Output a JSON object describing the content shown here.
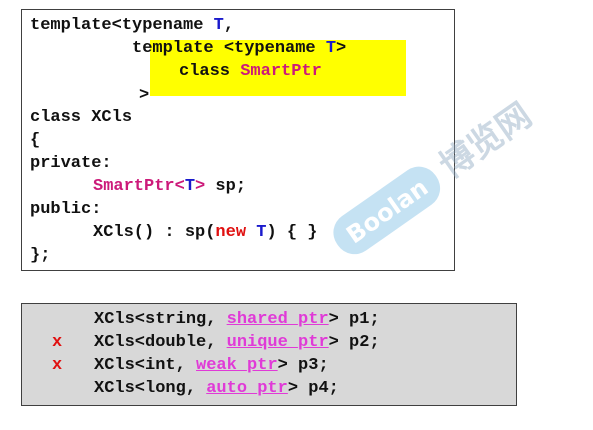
{
  "code_top": {
    "l1": {
      "a": "template<typename ",
      "b": "T",
      "c": ","
    },
    "l2": {
      "a": "template <typename ",
      "b": "T",
      "c": ">"
    },
    "l3": {
      "a": "class ",
      "b": "SmartPtr"
    },
    "l4": ">",
    "l5": "class XCls",
    "l6": "{",
    "l7": "private:",
    "l8": {
      "a": "SmartPtr",
      "b": "<",
      "c": "T",
      "d": ">",
      "e": " sp;"
    },
    "l9": "public:",
    "l10": {
      "a": "XCls() : sp(",
      "b": "new",
      "c": " ",
      "d": "T",
      "e": ") { }"
    },
    "l11": "};"
  },
  "code_bottom": {
    "rows": [
      {
        "mark": "",
        "pre": "XCls<string, ",
        "ptr": "shared_ptr",
        "post": "> p1;"
      },
      {
        "mark": "x",
        "pre": "XCls<double, ",
        "ptr": "unique_ptr",
        "post": "> p2;"
      },
      {
        "mark": "x",
        "pre": "XCls<int, ",
        "ptr": "weak_ptr",
        "post": "> p3;"
      },
      {
        "mark": "",
        "pre": "XCls<long, ",
        "ptr": "auto_ptr",
        "post": "> p4;"
      }
    ]
  },
  "watermark": {
    "logo": "Boolan",
    "cn": "博览网"
  },
  "colors": {
    "highlight": "#ffff00",
    "type_param": "#1a1acc",
    "class_name": "#cc1a7a",
    "keyword_new": "#e01010",
    "smart_ptr_types": "#e03ad7",
    "invalid_mark": "#e01010",
    "bottom_box_bg": "#d8d8d8"
  }
}
